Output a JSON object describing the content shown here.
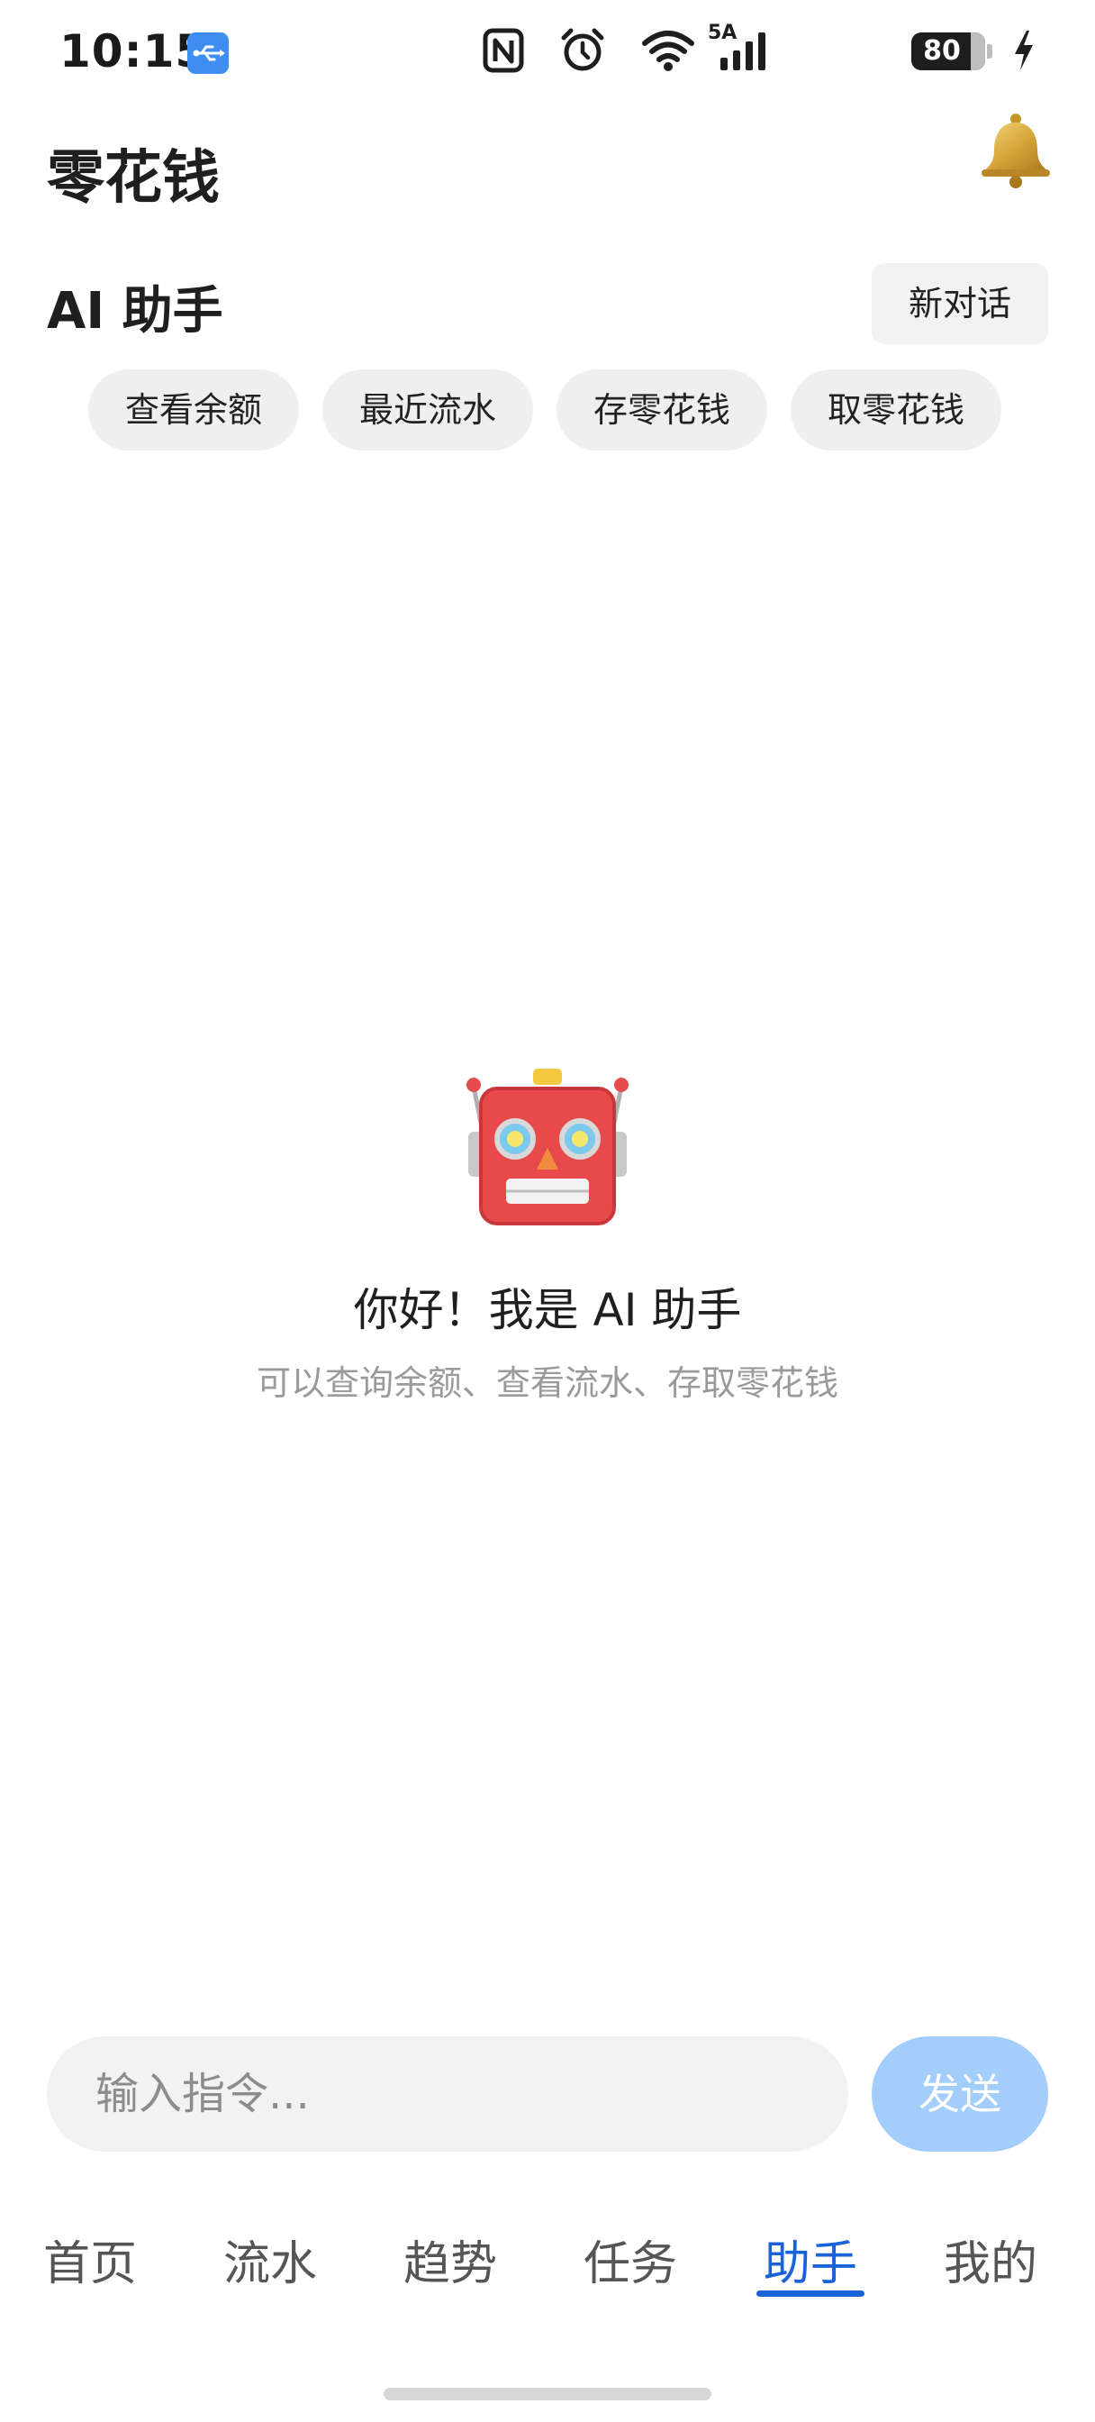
{
  "status_bar": {
    "time": "10:15",
    "usb_icon": "usb-icon",
    "nfc_icon": "nfc-icon",
    "alarm_icon": "alarm-icon",
    "wifi_icon": "wifi-icon",
    "network_type": "5A",
    "signal_icon": "signal-icon",
    "battery_level": "80",
    "charging_icon": "bolt-icon"
  },
  "header": {
    "app_title": "零花钱",
    "bell_icon": "bell-icon"
  },
  "assistant": {
    "title": "AI 助手",
    "new_chat_label": "新对话",
    "quick_actions": [
      "查看余额",
      "最近流水",
      "存零花钱",
      "取零花钱"
    ],
    "empty_state": {
      "icon": "robot-icon",
      "title": "你好！我是 AI 助手",
      "subtitle": "可以查询余额、查看流水、存取零花钱"
    }
  },
  "composer": {
    "placeholder": "输入指令...",
    "value": "",
    "send_label": "发送"
  },
  "bottom_nav": {
    "items": [
      "首页",
      "流水",
      "趋势",
      "任务",
      "助手",
      "我的"
    ],
    "active": "助手"
  },
  "colors": {
    "accent": "#1a62d8",
    "send_button_disabled": "#a3cdfa",
    "chip_background": "#efefef",
    "usb_badge": "#3d8ef0"
  }
}
